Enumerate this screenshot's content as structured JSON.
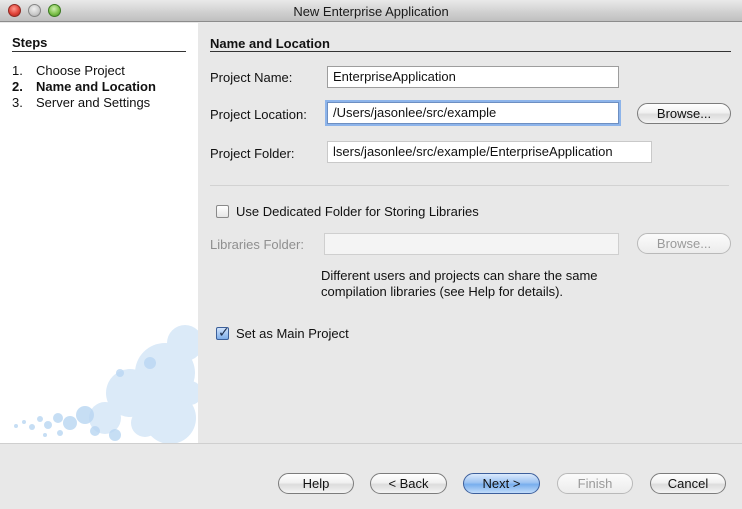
{
  "window": {
    "title": "New Enterprise Application"
  },
  "steps": {
    "title": "Steps",
    "items": [
      {
        "num": "1.",
        "label": "Choose Project",
        "current": false
      },
      {
        "num": "2.",
        "label": "Name and Location",
        "current": true
      },
      {
        "num": "3.",
        "label": "Server and Settings",
        "current": false
      }
    ]
  },
  "panel": {
    "title": "Name and Location",
    "project_name": {
      "label": "Project Name:",
      "value": "EnterpriseApplication"
    },
    "project_location": {
      "label": "Project Location:",
      "value": "/Users/jasonlee/src/example",
      "browse": "Browse..."
    },
    "project_folder": {
      "label": "Project Folder:",
      "value": "lsers/jasonlee/src/example/EnterpriseApplication"
    },
    "dedicated_folder": {
      "label": "Use Dedicated Folder for Storing Libraries",
      "checked": false
    },
    "libraries_folder": {
      "label": "Libraries Folder:",
      "value": "",
      "browse": "Browse..."
    },
    "help_text": "Different users and projects can share the same compilation libraries (see Help for details).",
    "main_project": {
      "label": "Set as Main Project",
      "checked": true
    }
  },
  "buttons": {
    "help": "Help",
    "back": "< Back",
    "next": "Next >",
    "finish": "Finish",
    "cancel": "Cancel"
  },
  "colors": {
    "focus_ring": "#8db4ea",
    "default_button": "#78aeed",
    "close_button": "#e0443a",
    "zoom_button": "#7fc24c"
  }
}
